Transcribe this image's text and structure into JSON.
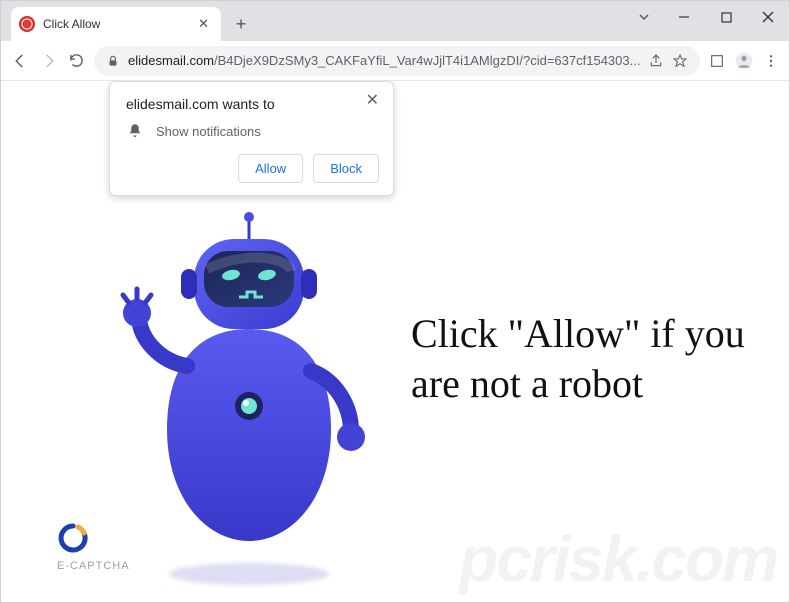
{
  "tab": {
    "title": "Click Allow"
  },
  "address": {
    "domain": "elidesmail.com",
    "path": "/B4DjeX9DzSMy3_CAKFaYfiL_Var4wJjlT4i1AMlgzDI/?cid=637cf154303..."
  },
  "permission": {
    "title": "elidesmail.com wants to",
    "item": "Show notifications",
    "allow": "Allow",
    "block": "Block"
  },
  "page": {
    "headline": "Click \"Allow\" if you are not a robot",
    "captcha_brand": "E-CAPTCHA"
  },
  "watermark": "pcrisk.com"
}
